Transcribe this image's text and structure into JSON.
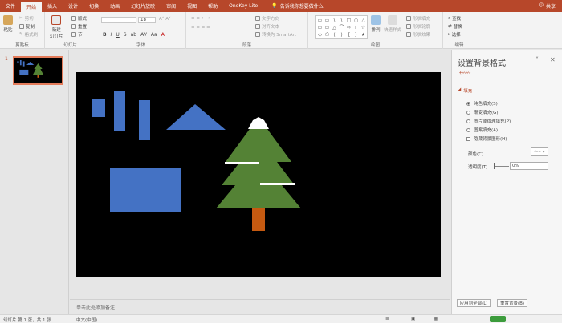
{
  "tabs": [
    "文件",
    "开始",
    "插入",
    "设计",
    "切换",
    "动画",
    "幻灯片放映",
    "审阅",
    "视图",
    "帮助",
    "OneKey Lite"
  ],
  "active_tab": "开始",
  "tell_me": "告诉我你想要做什么",
  "share": "共享",
  "ribbon": {
    "clipboard": {
      "paste": "粘贴",
      "cut": "剪切",
      "copy": "复制",
      "format_painter": "格式刷",
      "label": "剪贴板"
    },
    "slides": {
      "new_slide": "新建\n幻灯片",
      "layout": "版式",
      "reset": "重置",
      "section": "节",
      "label": "幻灯片"
    },
    "font": {
      "size": "18",
      "buttons": [
        "B",
        "I",
        "U",
        "S",
        "ab",
        "AV",
        "Aa",
        "A"
      ],
      "label": "字体"
    },
    "paragraph": {
      "text_direction": "文字方向",
      "align_text": "对齐文本",
      "smartart": "转换为 SmartArt",
      "label": "段落"
    },
    "drawing": {
      "arrange": "排列",
      "quick_styles": "快速样式",
      "shape_fill": "形状填充",
      "shape_outline": "形状轮廓",
      "shape_effects": "形状效果",
      "label": "绘图"
    },
    "editing": {
      "find": "查找",
      "replace": "替换",
      "select": "选择",
      "label": "编辑"
    }
  },
  "thumbnail_number": "1",
  "notes_placeholder": "单击此处添加备注",
  "pane": {
    "title": "设置背景格式",
    "section": "填充",
    "options": [
      "纯色填充(S)",
      "渐变填充(G)",
      "图片或纹理填充(P)",
      "图案填充(A)"
    ],
    "selected_option": "纯色填充(S)",
    "hide_graphics": "隐藏背景图形(H)",
    "color_label": "颜色(C)",
    "transparency_label": "透明度(T)",
    "transparency_value": "0%",
    "apply_all": "应用到全部(L)",
    "reset_bg": "重置背景(B)"
  },
  "status": {
    "slide_info": "幻灯片 第 1 张，共 1 张",
    "language": "中文(中国)"
  },
  "colors": {
    "accent": "#b7472a",
    "shape_blue": "#4472c4",
    "tree_green": "#548235",
    "trunk": "#c55a11",
    "snow": "#ffffff",
    "slide_bg": "#000000"
  }
}
